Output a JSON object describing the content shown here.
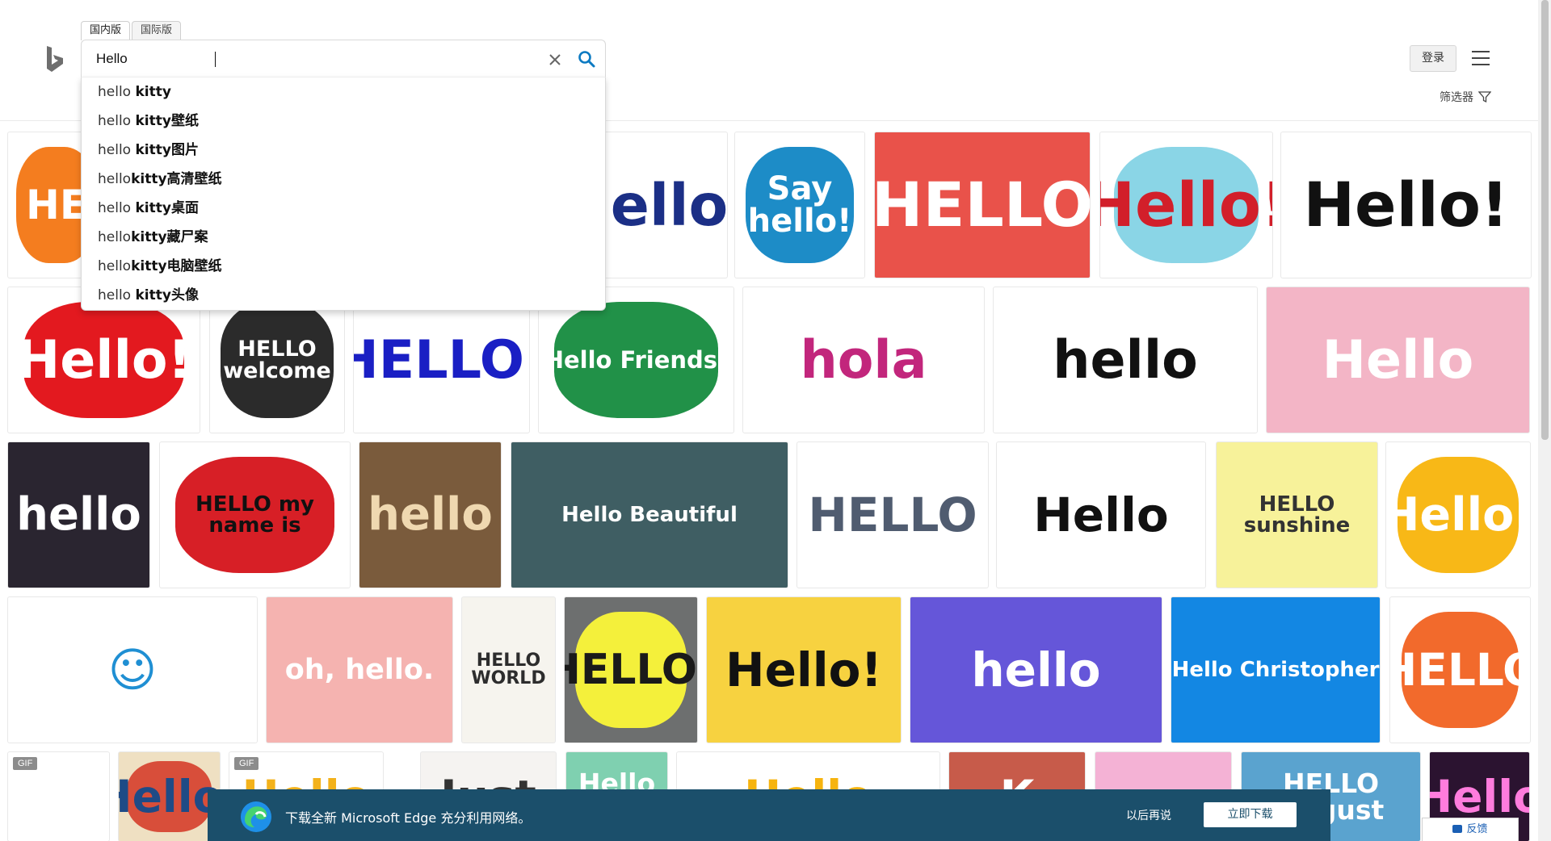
{
  "header": {
    "scope_tabs": [
      "国内版",
      "国际版"
    ],
    "search_value": "Hello ",
    "login_label": "登录",
    "filter_label": "筛选器"
  },
  "suggestions": [
    {
      "pre": "hello ",
      "bold": "kitty"
    },
    {
      "pre": "hello ",
      "bold": "kitty壁纸"
    },
    {
      "pre": "hello ",
      "bold": "kitty图片"
    },
    {
      "pre": "hello",
      "bold": "kitty高清壁纸"
    },
    {
      "pre": "hello ",
      "bold": "kitty桌面"
    },
    {
      "pre": "hello",
      "bold": "kitty藏尸案"
    },
    {
      "pre": "hello",
      "bold": "kitty电脑壁纸"
    },
    {
      "pre": "hello ",
      "bold": "kitty头像"
    }
  ],
  "images": [
    {
      "row": 0,
      "text": "HE",
      "bg": "#ffffff",
      "fg": "#ffffff",
      "accent": "#f47d1f"
    },
    {
      "row": 0,
      "text": "Hello!",
      "bg": "#ffffff",
      "fg": "#1b2f86"
    },
    {
      "row": 0,
      "text": "Say hello!",
      "bg": "#ffffff",
      "fg": "#ffffff",
      "accent": "#1d8cc7"
    },
    {
      "row": 0,
      "text": "HELLO",
      "bg": "#e9524a",
      "fg": "#ffffff"
    },
    {
      "row": 0,
      "text": "Hello!",
      "bg": "#ffffff",
      "fg": "#d21f2a",
      "accent": "#8ad5e6"
    },
    {
      "row": 0,
      "text": "Hello!",
      "bg": "#ffffff",
      "fg": "#111111"
    },
    {
      "row": 1,
      "text": "Hello!",
      "bg": "#ffffff",
      "fg": "#ffffff",
      "accent": "#e3191f"
    },
    {
      "row": 1,
      "text": "HELLO welcome",
      "bg": "#ffffff",
      "fg": "#ffffff",
      "accent": "#2b2b2b"
    },
    {
      "row": 1,
      "text": "HELLO!",
      "bg": "#ffffff",
      "fg": "#1a1fc4"
    },
    {
      "row": 1,
      "text": "Hello Friends!",
      "bg": "#ffffff",
      "fg": "#ffffff",
      "accent": "#219148"
    },
    {
      "row": 1,
      "text": "hola",
      "bg": "#ffffff",
      "fg": "#c2267c"
    },
    {
      "row": 1,
      "text": "hello",
      "bg": "#ffffff",
      "fg": "#111111"
    },
    {
      "row": 1,
      "text": "Hello",
      "bg": "#f3b5c6",
      "fg": "#ffffff"
    },
    {
      "row": 2,
      "text": "hello",
      "bg": "#2a2530",
      "fg": "#ffffff"
    },
    {
      "row": 2,
      "text": "HELLO my name is",
      "bg": "#ffffff",
      "fg": "#111111",
      "accent": "#d71f26"
    },
    {
      "row": 2,
      "text": "hello",
      "bg": "#7a5b3c",
      "fg": "#efd8b0"
    },
    {
      "row": 2,
      "text": "Hello Beautiful",
      "bg": "#3f5e63",
      "fg": "#ffffff"
    },
    {
      "row": 2,
      "text": "HELLO",
      "bg": "#ffffff",
      "fg": "#505c70"
    },
    {
      "row": 2,
      "text": "Hello",
      "bg": "#ffffff",
      "fg": "#111111"
    },
    {
      "row": 2,
      "text": "HELLO sunshine",
      "bg": "#f7f29a",
      "fg": "#333333"
    },
    {
      "row": 2,
      "text": "Hello!",
      "bg": "#ffffff",
      "fg": "#ffffff",
      "accent": "#f8b817"
    },
    {
      "row": 3,
      "text": "☺",
      "bg": "#ffffff",
      "fg": "#1f8fd3"
    },
    {
      "row": 3,
      "text": "oh, hello.",
      "bg": "#f5b3b0",
      "fg": "#ffffff"
    },
    {
      "row": 3,
      "text": "HELLO WORLD",
      "bg": "#f6f4ee",
      "fg": "#2d2d2d"
    },
    {
      "row": 3,
      "text": "HELLO!",
      "bg": "#6d6f6f",
      "fg": "#1a1a1a",
      "accent": "#f4f03b"
    },
    {
      "row": 3,
      "text": "Hello!",
      "bg": "#f7d240",
      "fg": "#111111"
    },
    {
      "row": 3,
      "text": "hello",
      "bg": "#6556d9",
      "fg": "#ffffff"
    },
    {
      "row": 3,
      "text": "Hello Christopher",
      "bg": "#1387e3",
      "fg": "#ffffff"
    },
    {
      "row": 3,
      "text": "HELLO",
      "bg": "#ffffff",
      "fg": "#ffffff",
      "accent": "#f26a2c"
    },
    {
      "row": 4,
      "text": "GIF",
      "bg": "#ffffff",
      "fg": "#d3337a",
      "gif": true
    },
    {
      "row": 4,
      "text": "Hello!",
      "bg": "#efe0c2",
      "fg": "#1f4b86",
      "accent": "#d84e3a"
    },
    {
      "row": 4,
      "text": "Hello",
      "bg": "#ffffff",
      "fg": "#f3b21b",
      "gif": true
    },
    {
      "row": 4,
      "text": "Just",
      "bg": "#f5f3f1",
      "fg": "#333333"
    },
    {
      "row": 4,
      "text": "Hello March",
      "bg": "#7fd0b0",
      "fg": "#ffffff"
    },
    {
      "row": 4,
      "text": "Hello",
      "bg": "#ffffff",
      "fg": "#f6b40f"
    },
    {
      "row": 4,
      "text": "K",
      "bg": "#c75b4a",
      "fg": "#ffffff"
    },
    {
      "row": 4,
      "text": "",
      "bg": "#f4b2d5",
      "fg": "#ffffff"
    },
    {
      "row": 4,
      "text": "HELLO August",
      "bg": "#5aa3cf",
      "fg": "#ffffff"
    },
    {
      "row": 4,
      "text": "Hello",
      "bg": "#2b1330",
      "fg": "#ff7cdd"
    }
  ],
  "edge_banner": {
    "message": "下载全新 Microsoft Edge 充分利用网络。",
    "later_label": "以后再说",
    "download_label": "立即下载"
  },
  "feedback_label": "反馈"
}
